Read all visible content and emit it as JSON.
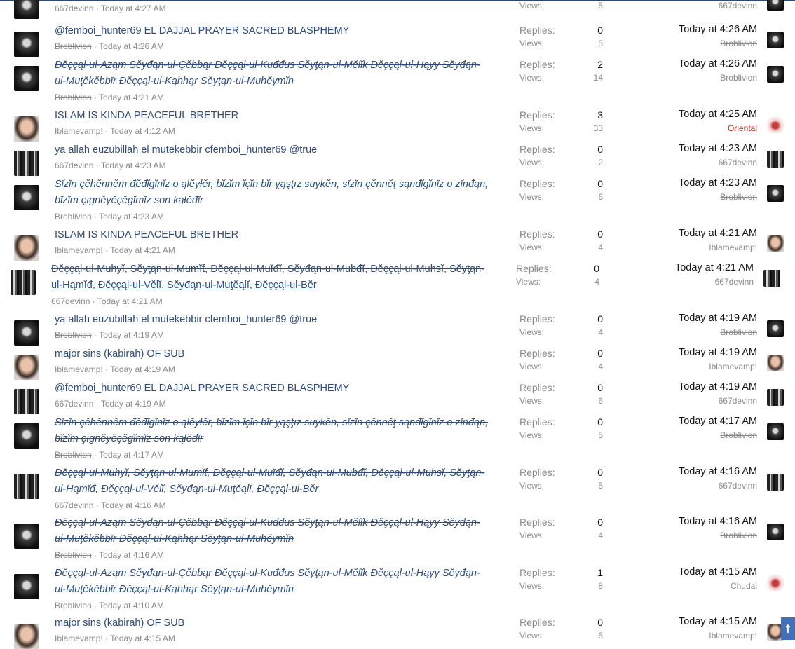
{
  "scroll_top_label": "↑",
  "labels": {
    "replies": "Replies:",
    "views": "Views:"
  },
  "threads": [
    {
      "title": "",
      "author": "667devinn",
      "author_strike": false,
      "started": "Today at 4:27 AM",
      "replies": "",
      "views": "5",
      "last_time": "",
      "last_user": "667devinn",
      "last_user_style": "",
      "avatar": "dark",
      "last_avatar": "dark"
    },
    {
      "title": "@femboi_hunter69 EL DAJJAL PRAYER SACRED BLASPHEMY",
      "author": "Broblivion",
      "author_strike": true,
      "started": "Today at 4:26 AM",
      "replies": "0",
      "views": "5",
      "last_time": "Today at 4:26 AM",
      "last_user": "Broblivion",
      "last_user_style": "strike",
      "avatar": "dark",
      "last_avatar": "dark"
    },
    {
      "title": "Đĕççąl-ul-Aząm Sĕyđąn-ul-Çĕbbąr Đĕççąl-ul-Kuđđus Sĕyƫąn-ul-Mĕlĭk Đĕççąl-ul-Hąyy Sĕyđąn-ul-Muƫĕkĕbbĭr Đĕççąl-ul-Kąhhąr Sĕyƫąn-ul-Muhĕymĭn",
      "title_style": "strike",
      "author": "Broblivion",
      "author_strike": true,
      "started": "Today at 4:21 AM",
      "replies": "2",
      "views": "14",
      "last_time": "Today at 4:26 AM",
      "last_user": "Broblivion",
      "last_user_style": "strike",
      "avatar": "dark",
      "last_avatar": "dark"
    },
    {
      "title": "ISLAM IS KINDA PEACEFUL BRETHER",
      "author": "Iblamevamp!",
      "author_strike": false,
      "started": "Today at 4:12 AM",
      "replies": "3",
      "views": "33",
      "last_time": "Today at 4:25 AM",
      "last_user": "Oriental",
      "last_user_style": "red",
      "avatar": "face",
      "last_avatar": "rose"
    },
    {
      "title": "ya allah euzubillah el mutekebbir cfemboi_hunter69 @true",
      "author": "667devinn",
      "author_strike": false,
      "started": "Today at 4:23 AM",
      "replies": "0",
      "views": "2",
      "last_time": "Today at 4:23 AM",
      "last_user": "667devinn",
      "last_user_style": "",
      "avatar": "crowd",
      "last_avatar": "crowd"
    },
    {
      "title": "Sĭzĭn çĕhĕnnĕm đĕđĭgĭnĭz o ąlĕyƚĕr, bĭzĭm ĭçĭn bĭr ỵąşƫız suykĕn, sĭzĭn çĕnnĕƫ sąnđĭgĭnĭz o zĭnđąn, bĭzĭm çıgnĕyĕçĕgĭmĭz son kąƚĕđĭr",
      "title_style": "strike",
      "author": "Broblivion",
      "author_strike": true,
      "started": "Today at 4:23 AM",
      "replies": "0",
      "views": "6",
      "last_time": "Today at 4:23 AM",
      "last_user": "Broblivion",
      "last_user_style": "strike",
      "avatar": "dark",
      "last_avatar": "dark"
    },
    {
      "title": "ISLAM IS KINDA PEACEFUL BRETHER",
      "author": "Iblamevamp!",
      "author_strike": false,
      "started": "Today at 4:21 AM",
      "replies": "0",
      "views": "4",
      "last_time": "Today at 4:21 AM",
      "last_user": "Iblamevamp!",
      "last_user_style": "",
      "avatar": "face",
      "last_avatar": "face"
    },
    {
      "title": "Đĕççąl-ul-Muhyĭ, Sĕyƫąn-ul-Mumĭƭ, Đĕççąl-ul-Muĭđĭ, Sĕyđąn-ul-Mubđĭ, Đĕççąl-ul-Muhsĭ, Sĕyƫąn-ul-Hąmĭđ, Đĕççąl-ul-Vĕlĭ, Sĕyđąn-ul-Muƫĕąlĭ, Đĕççąl-ul-Bĕr",
      "title_style": "hl",
      "author": "667devinn",
      "author_strike": false,
      "started": "Today at 4:21 AM",
      "replies": "0",
      "views": "4",
      "last_time": "Today at 4:21 AM",
      "last_user": "667devinn",
      "last_user_style": "",
      "avatar": "crowd",
      "last_avatar": "crowd"
    },
    {
      "title": "ya allah euzubillah el mutekebbir cfemboi_hunter69 @true",
      "author": "Broblivion",
      "author_strike": true,
      "started": "Today at 4:19 AM",
      "replies": "0",
      "views": "4",
      "last_time": "Today at 4:19 AM",
      "last_user": "Broblivion",
      "last_user_style": "strike",
      "avatar": "dark",
      "last_avatar": "dark"
    },
    {
      "title": "major sins (kabirah) OF SUB",
      "author": "Iblamevamp!",
      "author_strike": false,
      "started": "Today at 4:19 AM",
      "replies": "0",
      "views": "4",
      "last_time": "Today at 4:19 AM",
      "last_user": "Iblamevamp!",
      "last_user_style": "",
      "avatar": "face",
      "last_avatar": "face"
    },
    {
      "title": "@femboi_hunter69 EL DAJJAL PRAYER SACRED BLASPHEMY",
      "author": "667devinn",
      "author_strike": false,
      "started": "Today at 4:19 AM",
      "replies": "0",
      "views": "6",
      "last_time": "Today at 4:19 AM",
      "last_user": "667devinn",
      "last_user_style": "",
      "avatar": "crowd",
      "last_avatar": "crowd"
    },
    {
      "title": "Sĭzĭn çĕhĕnnĕm đĕđĭgĭnĭz o ąlĕyƚĕr, bĭzĭm ĭçĭn bĭr ỵąşƫız suykĕn, sĭzĭn çĕnnĕƫ sąnđĭgĭnĭz o zĭnđąn, bĭzĭm çıgnĕyĕçĕgĭmĭz son kąƚĕđĭr",
      "title_style": "strike",
      "author": "Broblivion",
      "author_strike": true,
      "started": "Today at 4:17 AM",
      "replies": "0",
      "views": "5",
      "last_time": "Today at 4:17 AM",
      "last_user": "Broblivion",
      "last_user_style": "strike",
      "avatar": "dark",
      "last_avatar": "dark"
    },
    {
      "title": "Đĕççąl-ul-Muhyĭ, Sĕyƫąn-ul-Mumĭƭ, Đĕççąl-ul-Muĭđĭ, Sĕyđąn-ul-Mubđĭ, Đĕççąl-ul-Muhsĭ, Sĕyƫąn-ul-Hąmĭđ, Đĕççąl-ul-Vĕlĭ, Sĕyđąn-ul-Muƫĕąlĭ, Đĕççąl-ul-Bĕr",
      "title_style": "strike",
      "author": "667devinn",
      "author_strike": false,
      "started": "Today at 4:16 AM",
      "replies": "0",
      "views": "5",
      "last_time": "Today at 4:16 AM",
      "last_user": "667devinn",
      "last_user_style": "",
      "avatar": "crowd",
      "last_avatar": "crowd"
    },
    {
      "title": "Đĕççąl-ul-Aząm Sĕyđąn-ul-Çĕbbąr Đĕççąl-ul-Kuđđus Sĕyƫąn-ul-Mĕlĭk Đĕççąl-ul-Hąyy Sĕyđąn-ul-Muƫĕkĕbbĭr Đĕççąl-ul-Kąhhąr Sĕyƫąn-ul-Muhĕymĭn",
      "title_style": "strike",
      "author": "Broblivion",
      "author_strike": true,
      "started": "Today at 4:16 AM",
      "replies": "0",
      "views": "4",
      "last_time": "Today at 4:16 AM",
      "last_user": "Broblivion",
      "last_user_style": "strike",
      "avatar": "dark",
      "last_avatar": "dark"
    },
    {
      "title": "Đĕççąl-ul-Aząm Sĕyđąn-ul-Çĕbbąr Đĕççąl-ul-Kuđđus Sĕyƫąn-ul-Mĕlĭk Đĕççąl-ul-Hąyy Sĕyđąn-ul-Muƫĕkĕbbĭr Đĕççąl-ul-Kąhhąr Sĕyƫąn-ul-Muhĕymĭn",
      "title_style": "strike",
      "author": "Broblivion",
      "author_strike": true,
      "started": "Today at 4:10 AM",
      "replies": "1",
      "views": "8",
      "last_time": "Today at 4:15 AM",
      "last_user": "Chudai",
      "last_user_style": "",
      "avatar": "dark",
      "last_avatar": "rose"
    },
    {
      "title": "major sins (kabirah) OF SUB",
      "author": "Iblamevamp!",
      "author_strike": false,
      "started": "Today at 4:15 AM",
      "replies": "0",
      "views": "5",
      "last_time": "Today at 4:15 AM",
      "last_user": "Iblamevamp!",
      "last_user_style": "",
      "avatar": "face",
      "last_avatar": "face"
    }
  ]
}
